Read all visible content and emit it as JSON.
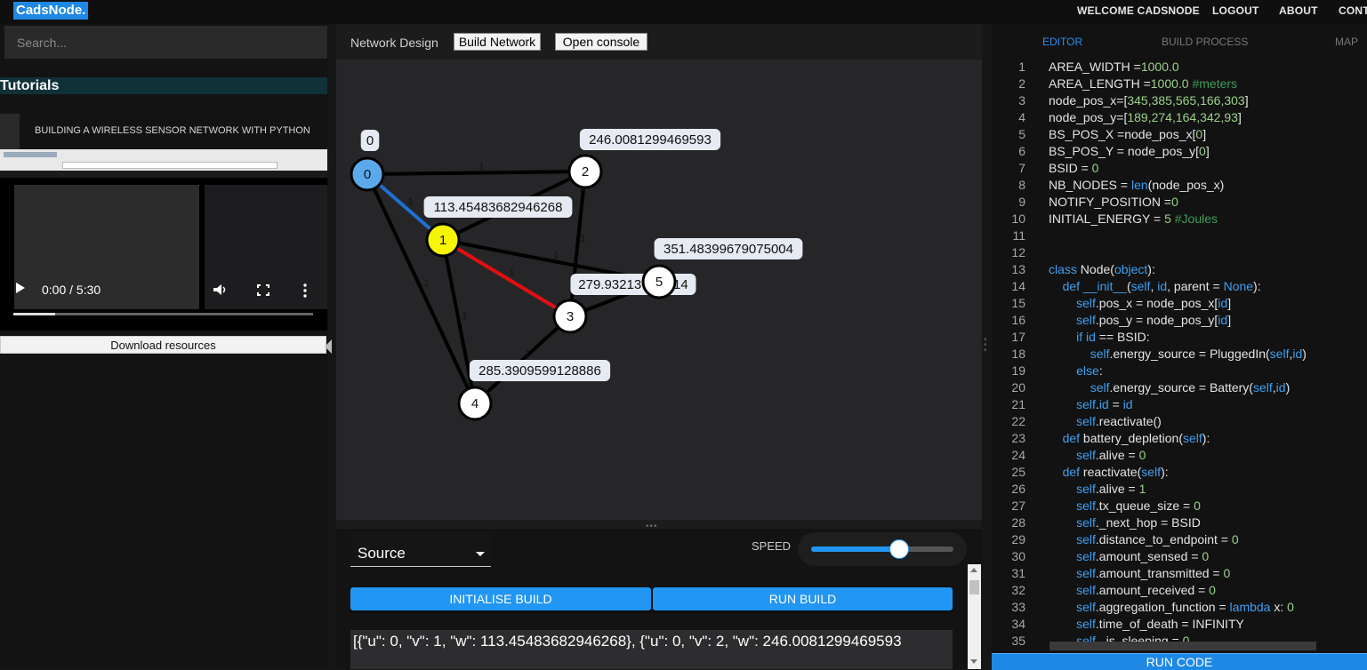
{
  "app": {
    "logo": "CadsNode.",
    "nav": [
      "WELCOME CADSNODE",
      "LOGOUT",
      "ABOUT",
      "CONT"
    ]
  },
  "sidebar": {
    "search_placeholder": "Search...",
    "section_title": "Tutorials",
    "tutorial_title": "BUILDING A WIRELESS SENSOR NETWORK WITH PYTHON",
    "video": {
      "time": "0:00 / 5:30",
      "progress": 0.14
    },
    "download_label": "Download resources"
  },
  "network": {
    "label": "Network Design",
    "build_button": "Build Network",
    "console_button": "Open console",
    "nodes": [
      {
        "id": "0",
        "color": "#5ba9ea",
        "label": "0"
      },
      {
        "id": "1",
        "color": "#f7f500",
        "label": "113.45483682946268"
      },
      {
        "id": "2",
        "color": "#ffffff",
        "label": "246.0081299469593"
      },
      {
        "id": "3",
        "color": "#ffffff",
        "label": ""
      },
      {
        "id": "4",
        "color": "#ffffff",
        "label": "285.3909599128886"
      },
      {
        "id": "5",
        "color": "#ffffff",
        "label": "351.48399679075004"
      }
    ],
    "overlap_label": "279.93213….6414",
    "edges": [
      {
        "u": "0",
        "v": "1",
        "w": "1",
        "color": "#1e6fd0"
      },
      {
        "u": "0",
        "v": "2",
        "w": "1",
        "color": "#000000"
      },
      {
        "u": "0",
        "v": "4",
        "w": "1",
        "color": "#000000"
      },
      {
        "u": "1",
        "v": "2",
        "w": "1",
        "color": "#000000"
      },
      {
        "u": "1",
        "v": "3",
        "w": "1",
        "color": "#e01010"
      },
      {
        "u": "1",
        "v": "4",
        "w": "1",
        "color": "#000000"
      },
      {
        "u": "1",
        "v": "5",
        "w": "1",
        "color": "#000000"
      },
      {
        "u": "2",
        "v": "3",
        "w": "1",
        "color": "#000000"
      },
      {
        "u": "3",
        "v": "4",
        "w": "1",
        "color": "#000000"
      },
      {
        "u": "3",
        "v": "5",
        "w": "1",
        "color": "#000000"
      }
    ]
  },
  "controls": {
    "source_label": "Source",
    "speed_label": "SPEED",
    "speed_value": 0.62,
    "init_button": "INITIALISE BUILD",
    "run_button": "RUN BUILD",
    "output": "[{\"u\": 0, \"v\": 1, \"w\": 113.45483682946268}, {\"u\": 0, \"v\": 2, \"w\": 246.0081299469593"
  },
  "editor": {
    "tabs": [
      "EDITOR",
      "BUILD PROCESS",
      "MAP"
    ],
    "run_label": "RUN CODE",
    "lines": [
      [
        [
          "AREA_WIDTH =",
          ""
        ],
        [
          "1000.0",
          "num"
        ]
      ],
      [
        [
          "AREA_LENGTH =",
          ""
        ],
        [
          "1000.0 ",
          "num"
        ],
        [
          "#meters",
          "com"
        ]
      ],
      [
        [
          "node_pos_x=[",
          ""
        ],
        [
          "345,385,565,166,303",
          "num"
        ],
        [
          "]",
          ""
        ]
      ],
      [
        [
          "node_pos_y=[",
          ""
        ],
        [
          "189,274,164,342,93",
          "num"
        ],
        [
          "]",
          ""
        ]
      ],
      [
        [
          "BS_POS_X =node_pos_x[",
          ""
        ],
        [
          "0",
          "num"
        ],
        [
          "]",
          ""
        ]
      ],
      [
        [
          "BS_POS_Y = node_pos_y[",
          ""
        ],
        [
          "0",
          "num"
        ],
        [
          "]",
          ""
        ]
      ],
      [
        [
          "BSID = ",
          ""
        ],
        [
          "0",
          "num"
        ]
      ],
      [
        [
          "NB_NODES = ",
          ""
        ],
        [
          "len",
          "kw"
        ],
        [
          "(node_pos_x)",
          ""
        ]
      ],
      [
        [
          "NOTIFY_POSITION =",
          ""
        ],
        [
          "0",
          "num"
        ]
      ],
      [
        [
          "INITIAL_ENERGY = ",
          ""
        ],
        [
          "5 ",
          "num"
        ],
        [
          "#Joules",
          "com"
        ]
      ],
      [],
      [],
      [
        [
          "class ",
          "kw"
        ],
        [
          "Node(",
          ""
        ],
        [
          "object",
          "kw"
        ],
        [
          "):",
          ""
        ]
      ],
      [
        [
          "    ",
          ""
        ],
        [
          "def ",
          "kw"
        ],
        [
          "__init__",
          "kw"
        ],
        [
          "(",
          ""
        ],
        [
          "self",
          "kw"
        ],
        [
          ", ",
          ""
        ],
        [
          "id",
          "kw"
        ],
        [
          ", parent = ",
          ""
        ],
        [
          "None",
          "kw"
        ],
        [
          "):",
          ""
        ]
      ],
      [
        [
          "        ",
          ""
        ],
        [
          "self",
          "kw"
        ],
        [
          ".pos_x = node_pos_x[",
          ""
        ],
        [
          "id",
          "kw"
        ],
        [
          "]",
          ""
        ]
      ],
      [
        [
          "        ",
          ""
        ],
        [
          "self",
          "kw"
        ],
        [
          ".pos_y = node_pos_y[",
          ""
        ],
        [
          "id",
          "kw"
        ],
        [
          "]",
          ""
        ]
      ],
      [
        [
          "        ",
          ""
        ],
        [
          "if ",
          "kw"
        ],
        [
          "id",
          "kw"
        ],
        [
          " == BSID:",
          ""
        ]
      ],
      [
        [
          "            ",
          ""
        ],
        [
          "self",
          "kw"
        ],
        [
          ".energy_source = PluggedIn(",
          ""
        ],
        [
          "self",
          "kw"
        ],
        [
          ",",
          ""
        ],
        [
          "id",
          "kw"
        ],
        [
          ")",
          ""
        ]
      ],
      [
        [
          "        ",
          ""
        ],
        [
          "else",
          "kw"
        ],
        [
          ":",
          ""
        ]
      ],
      [
        [
          "            ",
          ""
        ],
        [
          "self",
          "kw"
        ],
        [
          ".energy_source = Battery(",
          ""
        ],
        [
          "self",
          "kw"
        ],
        [
          ",",
          ""
        ],
        [
          "id",
          "kw"
        ],
        [
          ")",
          ""
        ]
      ],
      [
        [
          "        ",
          ""
        ],
        [
          "self",
          "kw"
        ],
        [
          ".",
          ""
        ],
        [
          "id",
          "kw"
        ],
        [
          " = ",
          ""
        ],
        [
          "id",
          "kw"
        ]
      ],
      [
        [
          "        ",
          ""
        ],
        [
          "self",
          "kw"
        ],
        [
          ".reactivate()",
          ""
        ]
      ],
      [
        [
          "    ",
          ""
        ],
        [
          "def ",
          "kw"
        ],
        [
          "battery_depletion(",
          ""
        ],
        [
          "self",
          "kw"
        ],
        [
          "):",
          ""
        ]
      ],
      [
        [
          "        ",
          ""
        ],
        [
          "self",
          "kw"
        ],
        [
          ".alive = ",
          ""
        ],
        [
          "0",
          "num"
        ]
      ],
      [
        [
          "    ",
          ""
        ],
        [
          "def ",
          "kw"
        ],
        [
          "reactivate(",
          ""
        ],
        [
          "self",
          "kw"
        ],
        [
          "):",
          ""
        ]
      ],
      [
        [
          "        ",
          ""
        ],
        [
          "self",
          "kw"
        ],
        [
          ".alive = ",
          ""
        ],
        [
          "1",
          "num"
        ]
      ],
      [
        [
          "        ",
          ""
        ],
        [
          "self",
          "kw"
        ],
        [
          ".tx_queue_size = ",
          ""
        ],
        [
          "0",
          "num"
        ]
      ],
      [
        [
          "        ",
          ""
        ],
        [
          "self",
          "kw"
        ],
        [
          "._next_hop = BSID",
          ""
        ]
      ],
      [
        [
          "        ",
          ""
        ],
        [
          "self",
          "kw"
        ],
        [
          ".distance_to_endpoint = ",
          ""
        ],
        [
          "0",
          "num"
        ]
      ],
      [
        [
          "        ",
          ""
        ],
        [
          "self",
          "kw"
        ],
        [
          ".amount_sensed = ",
          ""
        ],
        [
          "0",
          "num"
        ]
      ],
      [
        [
          "        ",
          ""
        ],
        [
          "self",
          "kw"
        ],
        [
          ".amount_transmitted = ",
          ""
        ],
        [
          "0",
          "num"
        ]
      ],
      [
        [
          "        ",
          ""
        ],
        [
          "self",
          "kw"
        ],
        [
          ".amount_received = ",
          ""
        ],
        [
          "0",
          "num"
        ]
      ],
      [
        [
          "        ",
          ""
        ],
        [
          "self",
          "kw"
        ],
        [
          ".aggregation_function = ",
          ""
        ],
        [
          "lambda",
          "kw"
        ],
        [
          " x: ",
          ""
        ],
        [
          "0",
          "num"
        ]
      ],
      [
        [
          "        ",
          ""
        ],
        [
          "self",
          "kw"
        ],
        [
          ".time_of_death = INFINITY",
          ""
        ]
      ],
      [
        [
          "        ",
          ""
        ],
        [
          "self",
          "kw"
        ],
        [
          "._is_sleeping = ",
          ""
        ],
        [
          "0",
          "num"
        ]
      ]
    ]
  }
}
